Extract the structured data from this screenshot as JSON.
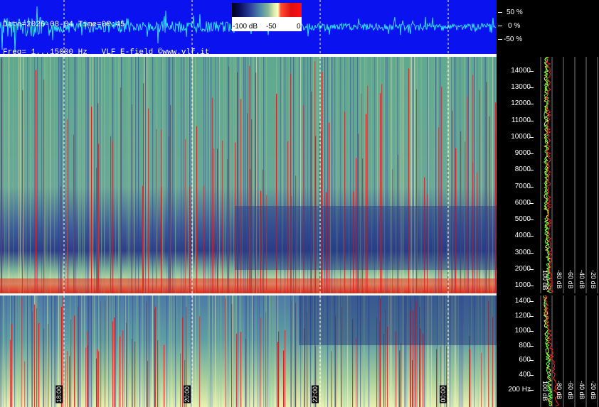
{
  "header": {
    "line1": "Date=2026-08-04 Time=00:45",
    "line2": "Freq= 1...15000 Hz   VLF E-field ©www.vlf.it"
  },
  "wave_scale": [
    "50 %",
    "0 %",
    "-50 %"
  ],
  "colorbar": {
    "labels": [
      "-100 dB",
      "-50",
      "0"
    ]
  },
  "top_freq_axis": [
    "14000",
    "13000",
    "12000",
    "11000",
    "10000",
    "9000",
    "8000",
    "7000",
    "6000",
    "5000",
    "4000",
    "3000",
    "2000",
    "1000"
  ],
  "bottom_freq_axis": [
    "1400",
    "1200",
    "1000",
    "800",
    "600",
    "400",
    "200 Hz"
  ],
  "time_markers": [
    "18:00",
    "20:00",
    "22:00",
    "00:00"
  ],
  "profile_db_labels": [
    "100 dB",
    "-80 dB",
    "-60 dB",
    "-40 dB",
    "-20 dB"
  ],
  "colors": {
    "wave_bg": "#0b12f0",
    "wave_trace": "#2de0ff",
    "profile_yellow": "#ffff40",
    "profile_green": "#40ff40",
    "profile_red": "#ff2020"
  }
}
